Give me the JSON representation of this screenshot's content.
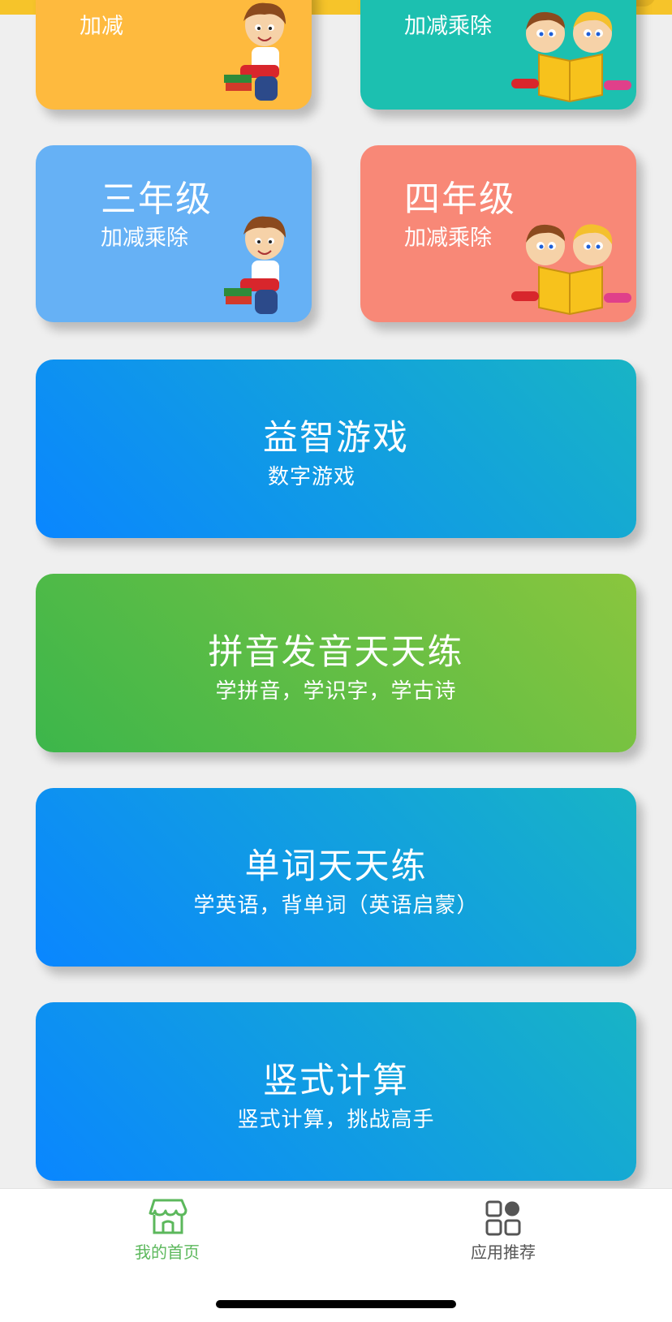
{
  "colors": {
    "yellow_card": "#feba3e",
    "teal_card": "#1cc0b0",
    "blue_card": "#66b1f5",
    "salmon_card": "#f88877",
    "tab_active": "#5cb85c",
    "tab_inactive": "#555555"
  },
  "grades": [
    {
      "title": "",
      "subtitle": "加减"
    },
    {
      "title": "",
      "subtitle": "加减乘除"
    },
    {
      "title": "三年级",
      "subtitle": "加减乘除"
    },
    {
      "title": "四年级",
      "subtitle": "加减乘除"
    }
  ],
  "features": [
    {
      "title": "益智游戏",
      "subtitle": "数字游戏"
    },
    {
      "title": "拼音发音天天练",
      "subtitle": "学拼音，学识字，学古诗"
    },
    {
      "title": "单词天天练",
      "subtitle": "学英语，背单词（英语启蒙）"
    },
    {
      "title": "竖式计算",
      "subtitle": "竖式计算，挑战高手"
    }
  ],
  "tabbar": {
    "home": {
      "label": "我的首页",
      "icon": "store-icon"
    },
    "apps": {
      "label": "应用推荐",
      "icon": "grid-icon"
    }
  }
}
